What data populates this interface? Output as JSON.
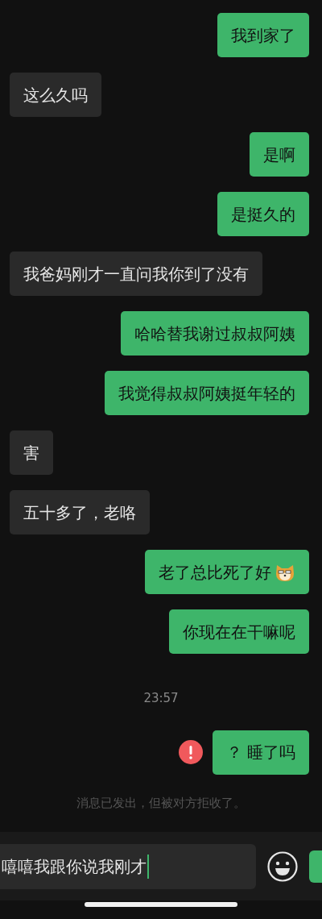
{
  "messages": [
    {
      "outgoing": true,
      "text": "我到家了"
    },
    {
      "outgoing": false,
      "text": "这么久吗"
    },
    {
      "outgoing": true,
      "text": "是啊"
    },
    {
      "outgoing": true,
      "text": "是挺久的"
    },
    {
      "outgoing": false,
      "text": "我爸妈刚才一直问我你到了没有"
    },
    {
      "outgoing": true,
      "text": "哈哈替我谢过叔叔阿姨"
    },
    {
      "outgoing": true,
      "text": "我觉得叔叔阿姨挺年轻的"
    },
    {
      "outgoing": false,
      "text": "害"
    },
    {
      "outgoing": false,
      "text": "五十多了，老咯"
    },
    {
      "outgoing": true,
      "text": "老了总比死了好",
      "sticker": true
    },
    {
      "outgoing": true,
      "text": "你现在在干嘛呢"
    }
  ],
  "timestamp": "23:57",
  "late_messages": [
    {
      "outgoing": true,
      "text": "？ 睡了吗",
      "failed": true
    }
  ],
  "notice": "消息已发出，但被对方拒收了。",
  "input": {
    "value": "嘻嘻我跟你说我刚才"
  }
}
